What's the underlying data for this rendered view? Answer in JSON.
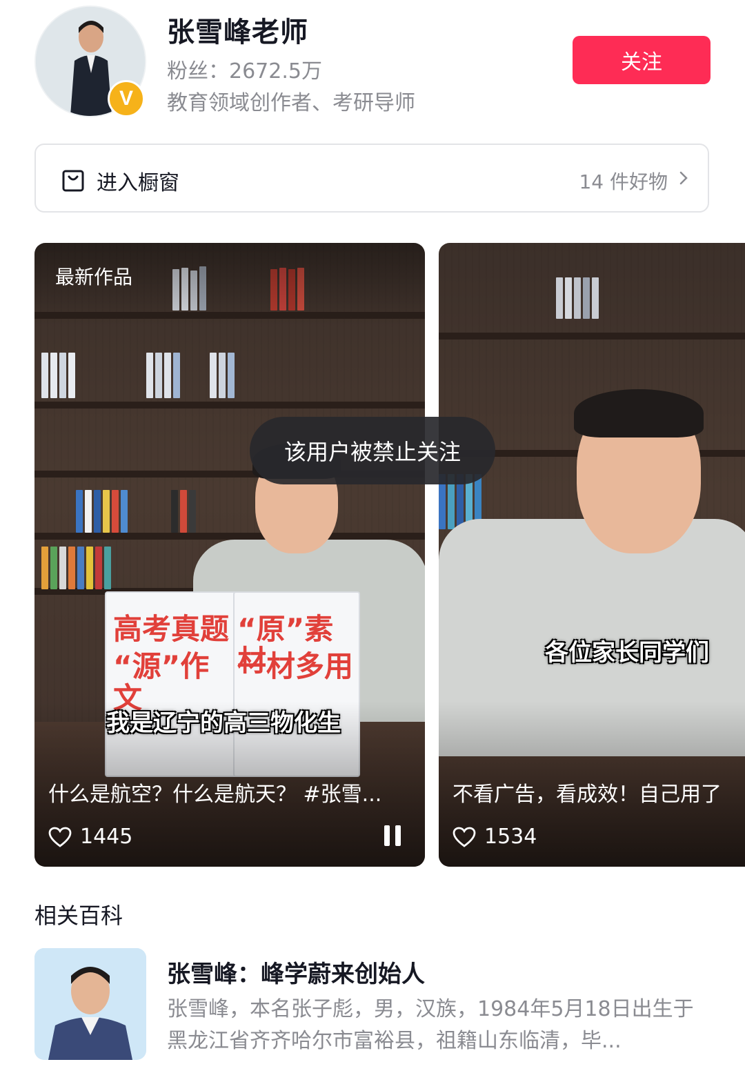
{
  "profile": {
    "name": "张雪峰老师",
    "fans": "粉丝：2672.5万",
    "description": "教育领域创作者、考研导师",
    "verify_badge": "V",
    "follow_label": "关注"
  },
  "showcase": {
    "label": "进入橱窗",
    "count": "14 件好物"
  },
  "videos": [
    {
      "tag": "最新作品",
      "cover_lines": [
        "高考真题",
        "“源”作文",
        "“原”素材",
        "一材多用"
      ],
      "subtitle": "我是辽宁的高三物化生",
      "title": "什么是航空？什么是航天？ #张雪...",
      "likes": "1445"
    },
    {
      "subtitle": "各位家长同学们",
      "title": "不看广告，看成效！自己用了",
      "likes": "1534"
    }
  ],
  "toast": "该用户被禁止关注",
  "related": {
    "section_title": "相关百科",
    "title": "张雪峰：峰学蔚来创始人",
    "summary": "张雪峰，本名张子彪，男，汉族，1984年5月18日出生于黑龙江省齐齐哈尔市富裕县，祖籍山东临清，毕..."
  },
  "colors": {
    "accent": "#fe2c55",
    "secondary_text": "#8a8b91",
    "badge": "#f6b21a"
  }
}
